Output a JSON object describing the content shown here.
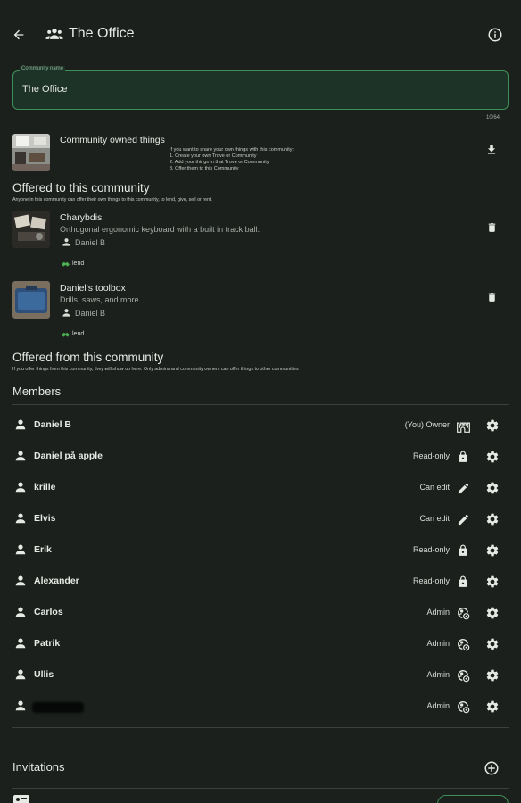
{
  "header": {
    "title": "The Office"
  },
  "name_field": {
    "label": "Community name",
    "value": "The Office",
    "counter": "10/64"
  },
  "community_owned": {
    "title": "Community owned things",
    "instructions": [
      "If you want to share your own things with this community:",
      "1. Create your own Trove or Community",
      "2. Add your things in that Trove or Community",
      "3. Offer them to this Community"
    ]
  },
  "offered_to": {
    "title": "Offered to this community",
    "subtitle": "Anyone in this community can offer their own things to this community, to lend, give, sell or rent.",
    "items": [
      {
        "title": "Charybdis",
        "description": "Orthogonal ergonomic keyboard with a built in track ball.",
        "owner": "Daniel B",
        "tag": "lend"
      },
      {
        "title": "Daniel's toolbox",
        "description": "Drills, saws, and more.",
        "owner": "Daniel B",
        "tag": "lend"
      }
    ]
  },
  "offered_from": {
    "title": "Offered from this community",
    "subtitle": "If you offer things from this community, they will show up here. Only admins and community owners can offer things to other communities"
  },
  "members": {
    "title": "Members",
    "list": [
      {
        "name": "Daniel B",
        "role": "(You)  Owner",
        "role_icon": "castle-icon"
      },
      {
        "name": "Daniel på apple",
        "role": "Read-only",
        "role_icon": "lock-icon"
      },
      {
        "name": "krille",
        "role": "Can edit",
        "role_icon": "pencil-icon"
      },
      {
        "name": "Elvis",
        "role": "Can edit",
        "role_icon": "pencil-icon"
      },
      {
        "name": "Erik",
        "role": "Read-only",
        "role_icon": "lock-icon"
      },
      {
        "name": "Alexander",
        "role": "Read-only",
        "role_icon": "lock-icon"
      },
      {
        "name": "Carlos",
        "role": "Admin",
        "role_icon": "admin-icon"
      },
      {
        "name": "Patrik",
        "role": "Admin",
        "role_icon": "admin-icon"
      },
      {
        "name": "Ullis",
        "role": "Admin",
        "role_icon": "admin-icon"
      },
      {
        "name": "",
        "role": "Admin",
        "role_icon": "admin-icon"
      }
    ]
  },
  "invitations": {
    "title": "Invitations"
  },
  "colors": {
    "background": "#1b201c",
    "accent": "#3f8f5a",
    "lend_green": "#4caf50"
  }
}
